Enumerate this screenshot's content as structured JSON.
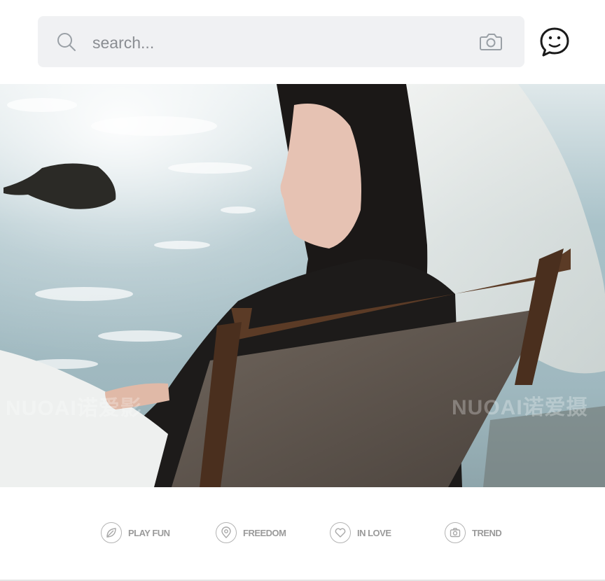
{
  "search": {
    "placeholder": "search...",
    "icon": "search-icon",
    "camera_icon": "camera-icon"
  },
  "header": {
    "chat_icon": "chat-icon"
  },
  "hero": {
    "watermark_left": "NUOAI诺爱影",
    "watermark_right": "NUOAI诺爱摄"
  },
  "nav": {
    "items": [
      {
        "label": "PLAY FUN",
        "icon": "leaf-icon"
      },
      {
        "label": "FREEDOM",
        "icon": "location-pin-icon"
      },
      {
        "label": "IN LOVE",
        "icon": "heart-icon"
      },
      {
        "label": "TREND",
        "icon": "camera-icon"
      }
    ]
  },
  "colors": {
    "search_bg": "#f0f1f3",
    "placeholder": "#8a8d92",
    "nav_text": "#9a9a9a",
    "nav_icon_stroke": "#b3b3b3"
  }
}
